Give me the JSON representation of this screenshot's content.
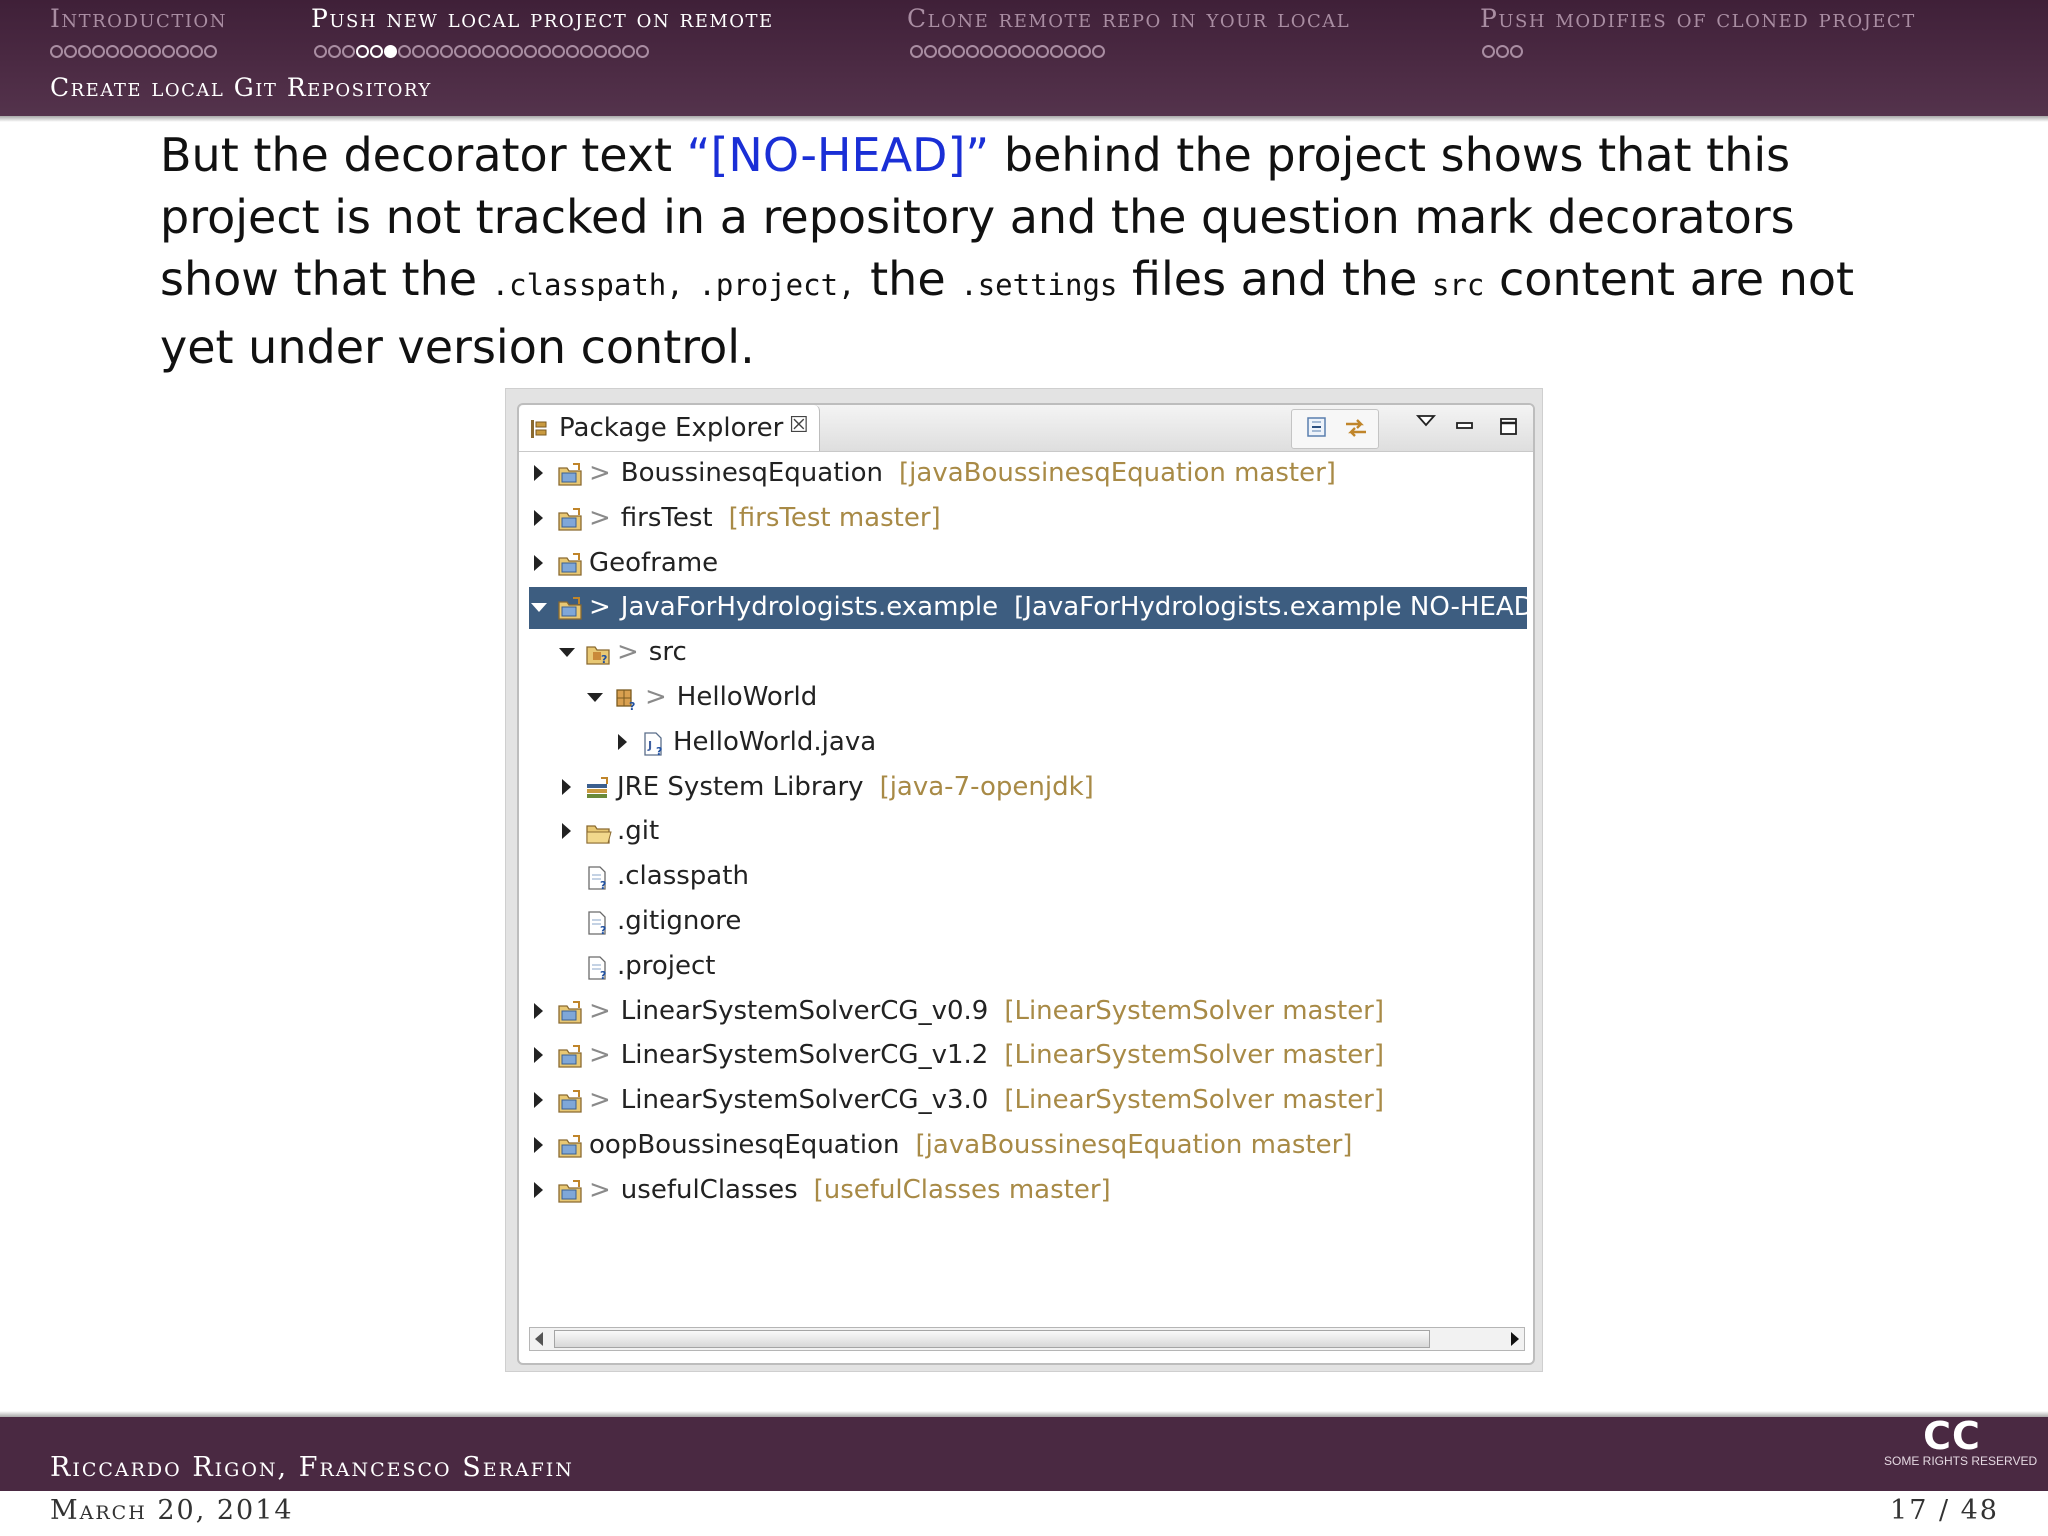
{
  "header": {
    "sections": [
      {
        "label": "Introduction",
        "active": false
      },
      {
        "label": "Push new local project on remote",
        "active": true
      },
      {
        "label": "Clone remote repo in your local",
        "active": false
      },
      {
        "label": "Push modifies of cloned project",
        "active": false
      }
    ],
    "subsection": "Create local Git Repository"
  },
  "paragraph": {
    "t1": "But the decorator text ",
    "highlight": "“[NO-HEAD]”",
    "t2": " behind the project shows that this project is not tracked in a repository and the question mark decorators show that the ",
    "code1": ".classpath,",
    "t3": " ",
    "code2": ".project,",
    "t4": " the ",
    "code3": ".settings",
    "t5": " files and the ",
    "code4": "src",
    "t6": " content are not yet under version control."
  },
  "package_explorer": {
    "tab_title": "Package Explorer",
    "tab_close": "☒",
    "toolbar_icons": [
      "collapse-all-icon",
      "link-with-editor-icon",
      "view-menu-icon",
      "minimize-icon",
      "maximize-icon"
    ],
    "rows": [
      {
        "arrow": "right",
        "icon": "project-icon",
        "gt": ">",
        "name": "BoussinesqEquation",
        "deco": "[javaBoussinesqEquation master]",
        "selected": false
      },
      {
        "arrow": "right",
        "icon": "project-icon",
        "gt": ">",
        "name": "firsTest",
        "deco": "[firsTest master]",
        "selected": false
      },
      {
        "arrow": "right",
        "icon": "project-icon",
        "gt": "",
        "name": "Geoframe",
        "deco": "",
        "selected": false
      },
      {
        "arrow": "down",
        "icon": "project-icon",
        "gt": ">",
        "name": "JavaForHydrologists.example",
        "deco": "[JavaForHydrologists.example NO-HEAD]",
        "selected": true
      },
      {
        "arrow": "down",
        "icon": "source-folder-icon",
        "gt": ">",
        "name": "src",
        "deco": "",
        "selected": false
      },
      {
        "arrow": "down",
        "icon": "package-icon",
        "gt": ">",
        "name": "HelloWorld",
        "deco": "",
        "selected": false
      },
      {
        "arrow": "right",
        "icon": "java-file-icon",
        "gt": "",
        "name": "HelloWorld.java",
        "deco": "",
        "selected": false
      },
      {
        "arrow": "right",
        "icon": "library-icon",
        "gt": "",
        "name": "JRE System Library",
        "deco": "[java-7-openjdk]",
        "selected": false
      },
      {
        "arrow": "right",
        "icon": "folder-icon",
        "gt": "",
        "name": ".git",
        "deco": "",
        "selected": false
      },
      {
        "arrow": "none",
        "icon": "file-icon",
        "gt": "",
        "name": ".classpath",
        "deco": "",
        "selected": false
      },
      {
        "arrow": "none",
        "icon": "file-icon",
        "gt": "",
        "name": ".gitignore",
        "deco": "",
        "selected": false
      },
      {
        "arrow": "none",
        "icon": "file-icon",
        "gt": "",
        "name": ".project",
        "deco": "",
        "selected": false
      },
      {
        "arrow": "right",
        "icon": "project-icon",
        "gt": ">",
        "name": "LinearSystemSolverCG_v0.9",
        "deco": "[LinearSystemSolver master]",
        "selected": false
      },
      {
        "arrow": "right",
        "icon": "project-icon",
        "gt": ">",
        "name": "LinearSystemSolverCG_v1.2",
        "deco": "[LinearSystemSolver master]",
        "selected": false
      },
      {
        "arrow": "right",
        "icon": "project-icon",
        "gt": ">",
        "name": "LinearSystemSolverCG_v3.0",
        "deco": "[LinearSystemSolver master]",
        "selected": false
      },
      {
        "arrow": "right",
        "icon": "project-icon",
        "gt": "",
        "name": "oopBoussinesqEquation",
        "deco": "[javaBoussinesqEquation master]",
        "selected": false
      },
      {
        "arrow": "right",
        "icon": "project-icon",
        "gt": ">",
        "name": "usefulClasses",
        "deco": "[usefulClasses master]",
        "selected": false
      }
    ]
  },
  "footer": {
    "authors": "Riccardo Rigon, Francesco Serafin",
    "date": "March 20, 2014",
    "page": "17 / 48",
    "cc_big": "CC",
    "cc_small": "SOME RIGHTS RESERVED"
  },
  "colors": {
    "theme": "#4a2942",
    "highlight_text": "#1a2fd6",
    "selection": "#3d5d80",
    "decorator": "#a88a46"
  }
}
